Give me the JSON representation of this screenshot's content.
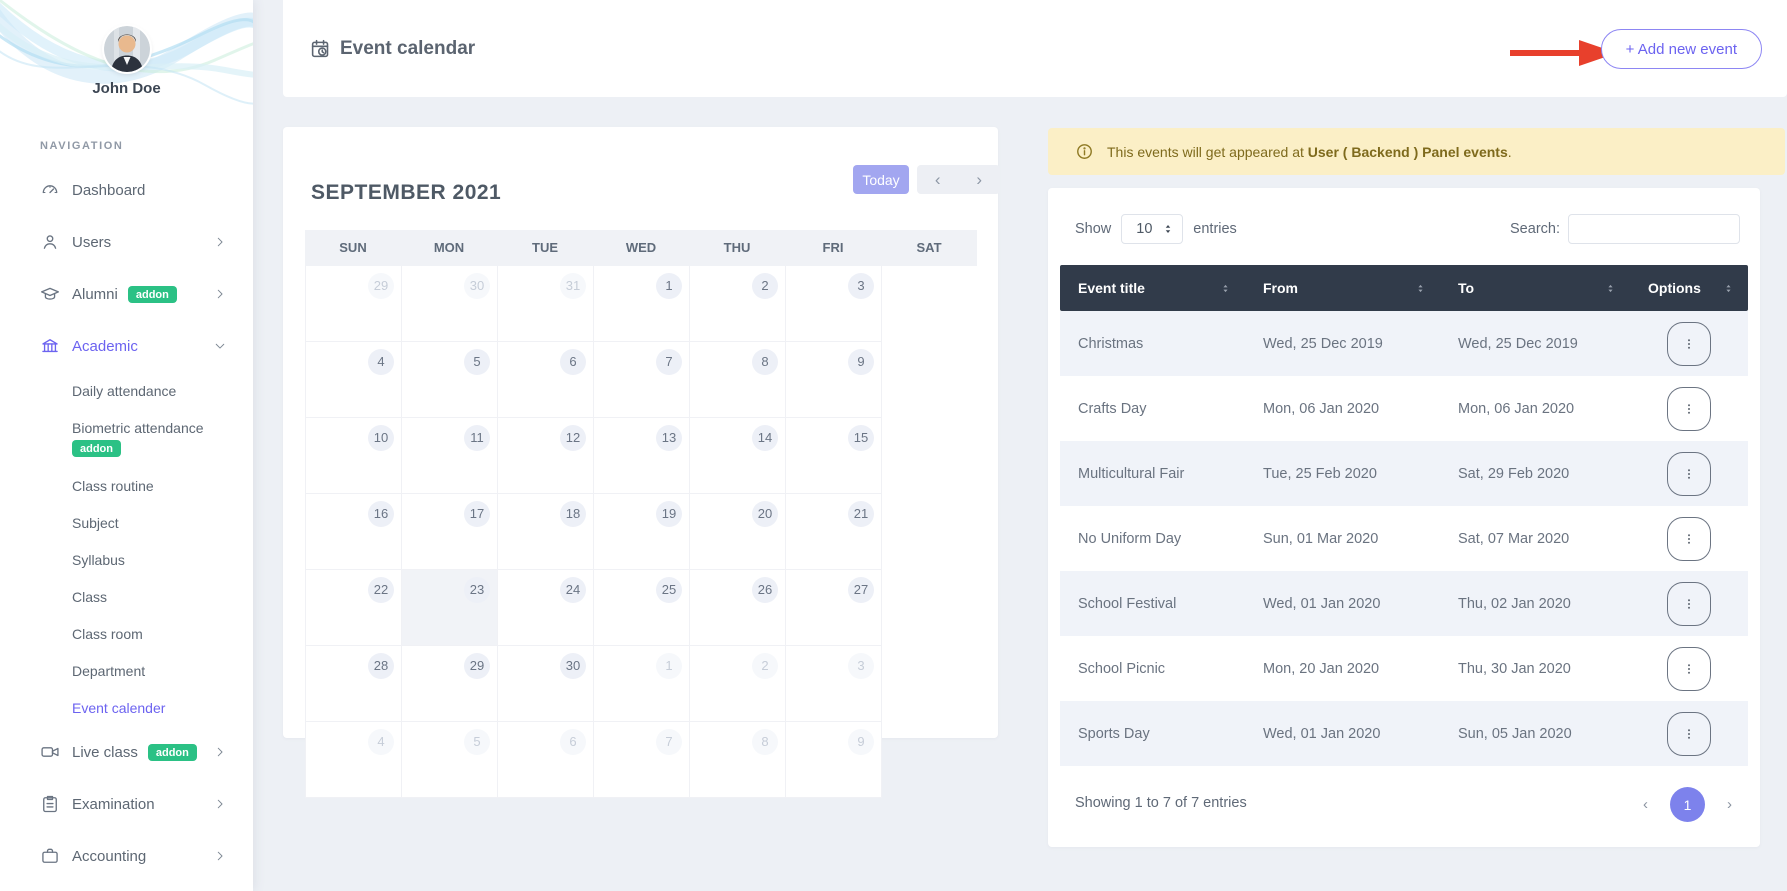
{
  "colors": {
    "accent": "#6c63f0",
    "today_button_bg": "#a2a6f0",
    "addon_badge_bg": "#2bc185",
    "table_header_bg": "#313b4a",
    "row_stripe_bg": "#f0f3f9",
    "alert_bg": "#fbefc6",
    "alert_text": "#7e6a1c",
    "arrow_red": "#e8402c",
    "page_bg": "#edf0f5"
  },
  "sidebar": {
    "user_name": "John Doe",
    "section_label": "NAVIGATION",
    "items": [
      {
        "label": "Dashboard",
        "icon": "gauge"
      },
      {
        "label": "Users",
        "icon": "user",
        "chevron": "right"
      },
      {
        "label": "Alumni",
        "icon": "grad-cap",
        "badge": "addon",
        "chevron": "right"
      },
      {
        "label": "Academic",
        "icon": "bank",
        "chevron": "down",
        "active": true,
        "children": [
          {
            "label": "Daily attendance"
          },
          {
            "label": "Biometric attendance",
            "badge": "addon"
          },
          {
            "label": "Class routine"
          },
          {
            "label": "Subject"
          },
          {
            "label": "Syllabus"
          },
          {
            "label": "Class"
          },
          {
            "label": "Class room"
          },
          {
            "label": "Department"
          },
          {
            "label": "Event calender",
            "active": true
          }
        ]
      },
      {
        "label": "Live class",
        "icon": "video",
        "badge": "addon",
        "chevron": "right"
      },
      {
        "label": "Examination",
        "icon": "clipboard",
        "chevron": "right"
      },
      {
        "label": "Accounting",
        "icon": "briefcase",
        "chevron": "right"
      }
    ]
  },
  "header": {
    "title": "Event calendar",
    "add_button": "+ Add new event"
  },
  "calendar": {
    "month_title": "SEPTEMBER 2021",
    "today_button": "Today",
    "prev_icon": "‹",
    "next_icon": "›",
    "day_headers": [
      "SUN",
      "MON",
      "TUE",
      "WED",
      "THU",
      "FRI",
      "SAT"
    ],
    "weeks": [
      [
        {
          "d": 29,
          "m": 1
        },
        {
          "d": 30,
          "m": 1
        },
        {
          "d": 31,
          "m": 1
        },
        {
          "d": 1
        },
        {
          "d": 2
        },
        {
          "d": 3
        },
        {
          "d": 4
        }
      ],
      [
        {
          "d": 5
        },
        {
          "d": 6
        },
        {
          "d": 7
        },
        {
          "d": 8
        },
        {
          "d": 9
        },
        {
          "d": 10
        },
        {
          "d": 11
        }
      ],
      [
        {
          "d": 12
        },
        {
          "d": 13
        },
        {
          "d": 14
        },
        {
          "d": 15
        },
        {
          "d": 16
        },
        {
          "d": 17
        },
        {
          "d": 18
        }
      ],
      [
        {
          "d": 19
        },
        {
          "d": 20
        },
        {
          "d": 21
        },
        {
          "d": 22
        },
        {
          "d": 23,
          "today": true
        },
        {
          "d": 24
        },
        {
          "d": 25
        }
      ],
      [
        {
          "d": 26
        },
        {
          "d": 27
        },
        {
          "d": 28
        },
        {
          "d": 29
        },
        {
          "d": 30
        },
        {
          "d": 1,
          "m": 1
        },
        {
          "d": 2,
          "m": 1
        }
      ],
      [
        {
          "d": 3,
          "m": 1
        },
        {
          "d": 4,
          "m": 1
        },
        {
          "d": 5,
          "m": 1
        },
        {
          "d": 6,
          "m": 1
        },
        {
          "d": 7,
          "m": 1
        },
        {
          "d": 8,
          "m": 1
        },
        {
          "d": 9,
          "m": 1
        }
      ]
    ]
  },
  "alert": {
    "text_prefix": "This events will get appeared at ",
    "text_bold": "User ( Backend ) Panel events",
    "text_suffix": "."
  },
  "table": {
    "show_label": "Show",
    "page_size": "10",
    "entries_label": "entries",
    "search_label": "Search:",
    "columns": [
      "Event title",
      "From",
      "To",
      "Options"
    ],
    "rows": [
      {
        "title": "Christmas",
        "from": "Wed, 25 Dec 2019",
        "to": "Wed, 25 Dec 2019"
      },
      {
        "title": "Crafts Day",
        "from": "Mon, 06 Jan 2020",
        "to": "Mon, 06 Jan 2020"
      },
      {
        "title": "Multicultural Fair",
        "from": "Tue, 25 Feb 2020",
        "to": "Sat, 29 Feb 2020"
      },
      {
        "title": "No Uniform Day",
        "from": "Sun, 01 Mar 2020",
        "to": "Sat, 07 Mar 2020"
      },
      {
        "title": "School Festival",
        "from": "Wed, 01 Jan 2020",
        "to": "Thu, 02 Jan 2020"
      },
      {
        "title": "School Picnic",
        "from": "Mon, 20 Jan 2020",
        "to": "Thu, 30 Jan 2020"
      },
      {
        "title": "Sports Day",
        "from": "Wed, 01 Jan 2020",
        "to": "Sun, 05 Jan 2020"
      }
    ],
    "footer": {
      "showing_text": "Showing 1 to 7 of 7 entries",
      "prev_icon": "‹",
      "page": "1",
      "next_icon": "›"
    }
  }
}
